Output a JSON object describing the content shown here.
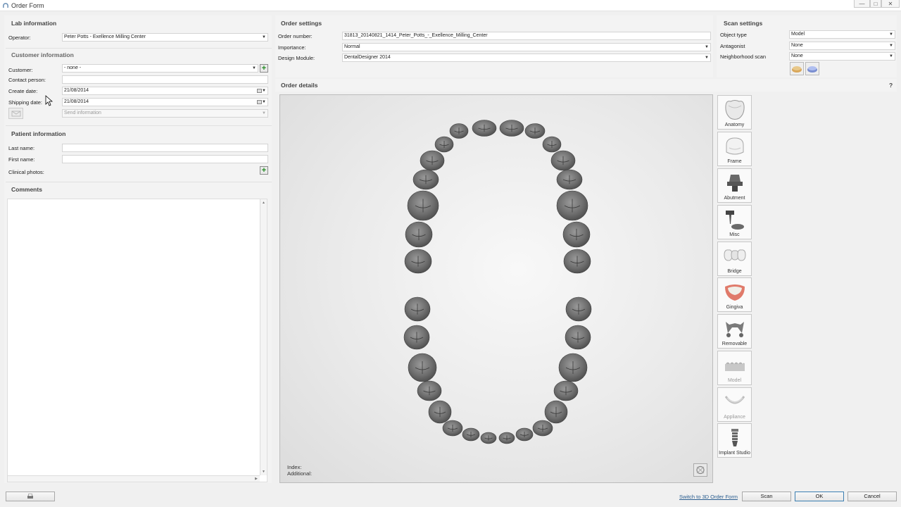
{
  "window": {
    "title": "Order Form"
  },
  "lab": {
    "header": "Lab information",
    "operator_label": "Operator:",
    "operator_value": "Peter Potts - Exellence Milling Center"
  },
  "customer": {
    "header": "Customer information",
    "customer_label": "Customer:",
    "customer_value": "- none -",
    "contact_label": "Contact person:",
    "contact_value": "",
    "create_label": "Create date:",
    "create_value": "21/08/2014",
    "shipping_label": "Shipping date:",
    "shipping_value": "21/08/2014",
    "send_placeholder": "Send information"
  },
  "patient": {
    "header": "Patient information",
    "last_label": "Last name:",
    "last_value": "",
    "first_label": "First name:",
    "first_value": "",
    "photos_label": "Clinical photos:"
  },
  "comments": {
    "header": "Comments",
    "value": ""
  },
  "order_settings": {
    "header": "Order settings",
    "number_label": "Order number:",
    "number_value": "31813_20140821_1414_Peter_Potts_-_Exellence_Milling_Center",
    "importance_label": "Importance:",
    "importance_value": "Normal",
    "module_label": "Design Module:",
    "module_value": "DentalDesigner 2014"
  },
  "scan_settings": {
    "header": "Scan settings",
    "object_label": "Object type",
    "object_value": "Model",
    "antagonist_label": "Antagonist",
    "antagonist_value": "None",
    "neighborhood_label": "Neighborhood scan",
    "neighborhood_value": "None"
  },
  "order_details": {
    "header": "Order details",
    "help": "?",
    "index_label": "Index:",
    "additional_label": "Additional:"
  },
  "restoration_types": [
    {
      "label": "Anatomy",
      "icon": "crown-icon",
      "enabled": true
    },
    {
      "label": "Frame",
      "icon": "coping-icon",
      "enabled": true
    },
    {
      "label": "Abutment",
      "icon": "abutment-icon",
      "enabled": true
    },
    {
      "label": "Misc",
      "icon": "post-icon",
      "enabled": true
    },
    {
      "label": "Bridge",
      "icon": "bridge-icon",
      "enabled": true
    },
    {
      "label": "Gingiva",
      "icon": "gingiva-icon",
      "enabled": true
    },
    {
      "label": "Removable",
      "icon": "removable-icon",
      "enabled": true
    },
    {
      "label": "Model",
      "icon": "model-icon",
      "enabled": false
    },
    {
      "label": "Appliance",
      "icon": "appliance-icon",
      "enabled": false
    },
    {
      "label": "Implant Studio",
      "icon": "implant-icon",
      "enabled": true
    }
  ],
  "footer": {
    "switch_link": "Switch to 3D Order Form",
    "scan": "Scan",
    "ok": "OK",
    "cancel": "Cancel"
  },
  "colors": {
    "tooth": "#6b6b6b",
    "accent": "#1f8a1f",
    "link": "#2a5d8f",
    "gingiva": "#e07a6a"
  }
}
